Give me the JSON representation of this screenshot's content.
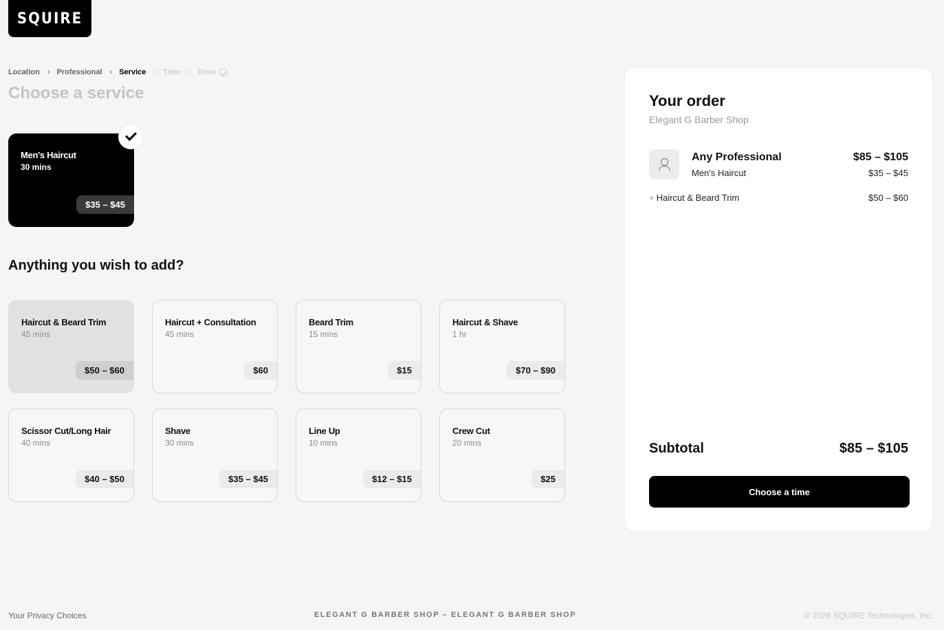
{
  "brand": {
    "logo_text": "SQUIRE"
  },
  "breadcrumb": {
    "items": [
      {
        "label": "Location",
        "state": "completed"
      },
      {
        "label": "Professional",
        "state": "completed"
      },
      {
        "label": "Service",
        "state": "active"
      },
      {
        "label": "Time",
        "state": "disabled"
      },
      {
        "label": "Done",
        "state": "disabled"
      }
    ]
  },
  "page": {
    "title": "Choose a service"
  },
  "selected_service": {
    "name": "Men's Haircut",
    "duration": "30 mins",
    "price": "$35 – $45",
    "selected_icon": "check-icon"
  },
  "addons": {
    "heading": "Anything you wish to add?",
    "items": [
      {
        "name": "Haircut & Beard Trim",
        "duration": "45 mins",
        "price": "$50 – $60",
        "selected": true
      },
      {
        "name": "Haircut + Consultation",
        "duration": "45 mins",
        "price": "$60",
        "selected": false
      },
      {
        "name": "Beard Trim",
        "duration": "15 mins",
        "price": "$15",
        "selected": false
      },
      {
        "name": "Haircut & Shave",
        "duration": "1 hr",
        "price": "$70 – $90",
        "selected": false
      },
      {
        "name": "Scissor Cut/Long Hair",
        "duration": "40 mins",
        "price": "$40 – $50",
        "selected": false
      },
      {
        "name": "Shave",
        "duration": "30 mins",
        "price": "$35 – $45",
        "selected": false
      },
      {
        "name": "Line Up",
        "duration": "10 mins",
        "price": "$12 – $15",
        "selected": false
      },
      {
        "name": "Crew Cut",
        "duration": "20 mins",
        "price": "$25",
        "selected": false
      }
    ]
  },
  "order": {
    "title": "Your order",
    "shop": "Elegant G Barber Shop",
    "professional": {
      "name": "Any Professional",
      "service": "Men's Haircut",
      "total": "$85 – $105",
      "service_price": "$35 – $45",
      "avatar_icon": "person-icon"
    },
    "addon": {
      "plus": "+",
      "name": "Haircut & Beard Trim",
      "price": "$50 – $60"
    },
    "subtotal_label": "Subtotal",
    "subtotal_value": "$85 – $105",
    "cta_label": "Choose a time"
  },
  "footer": {
    "privacy": "Your Privacy Choices",
    "center": "ELEGANT G BARBER SHOP – ELEGANT G BARBER SHOP",
    "copyright": "© 2026 SQUIRE Technologies, Inc."
  },
  "colors": {
    "background": "#f5f5f5",
    "primary": "#000000",
    "muted_title": "#c4c4c4",
    "card_highlight": "#e1e1e1"
  }
}
